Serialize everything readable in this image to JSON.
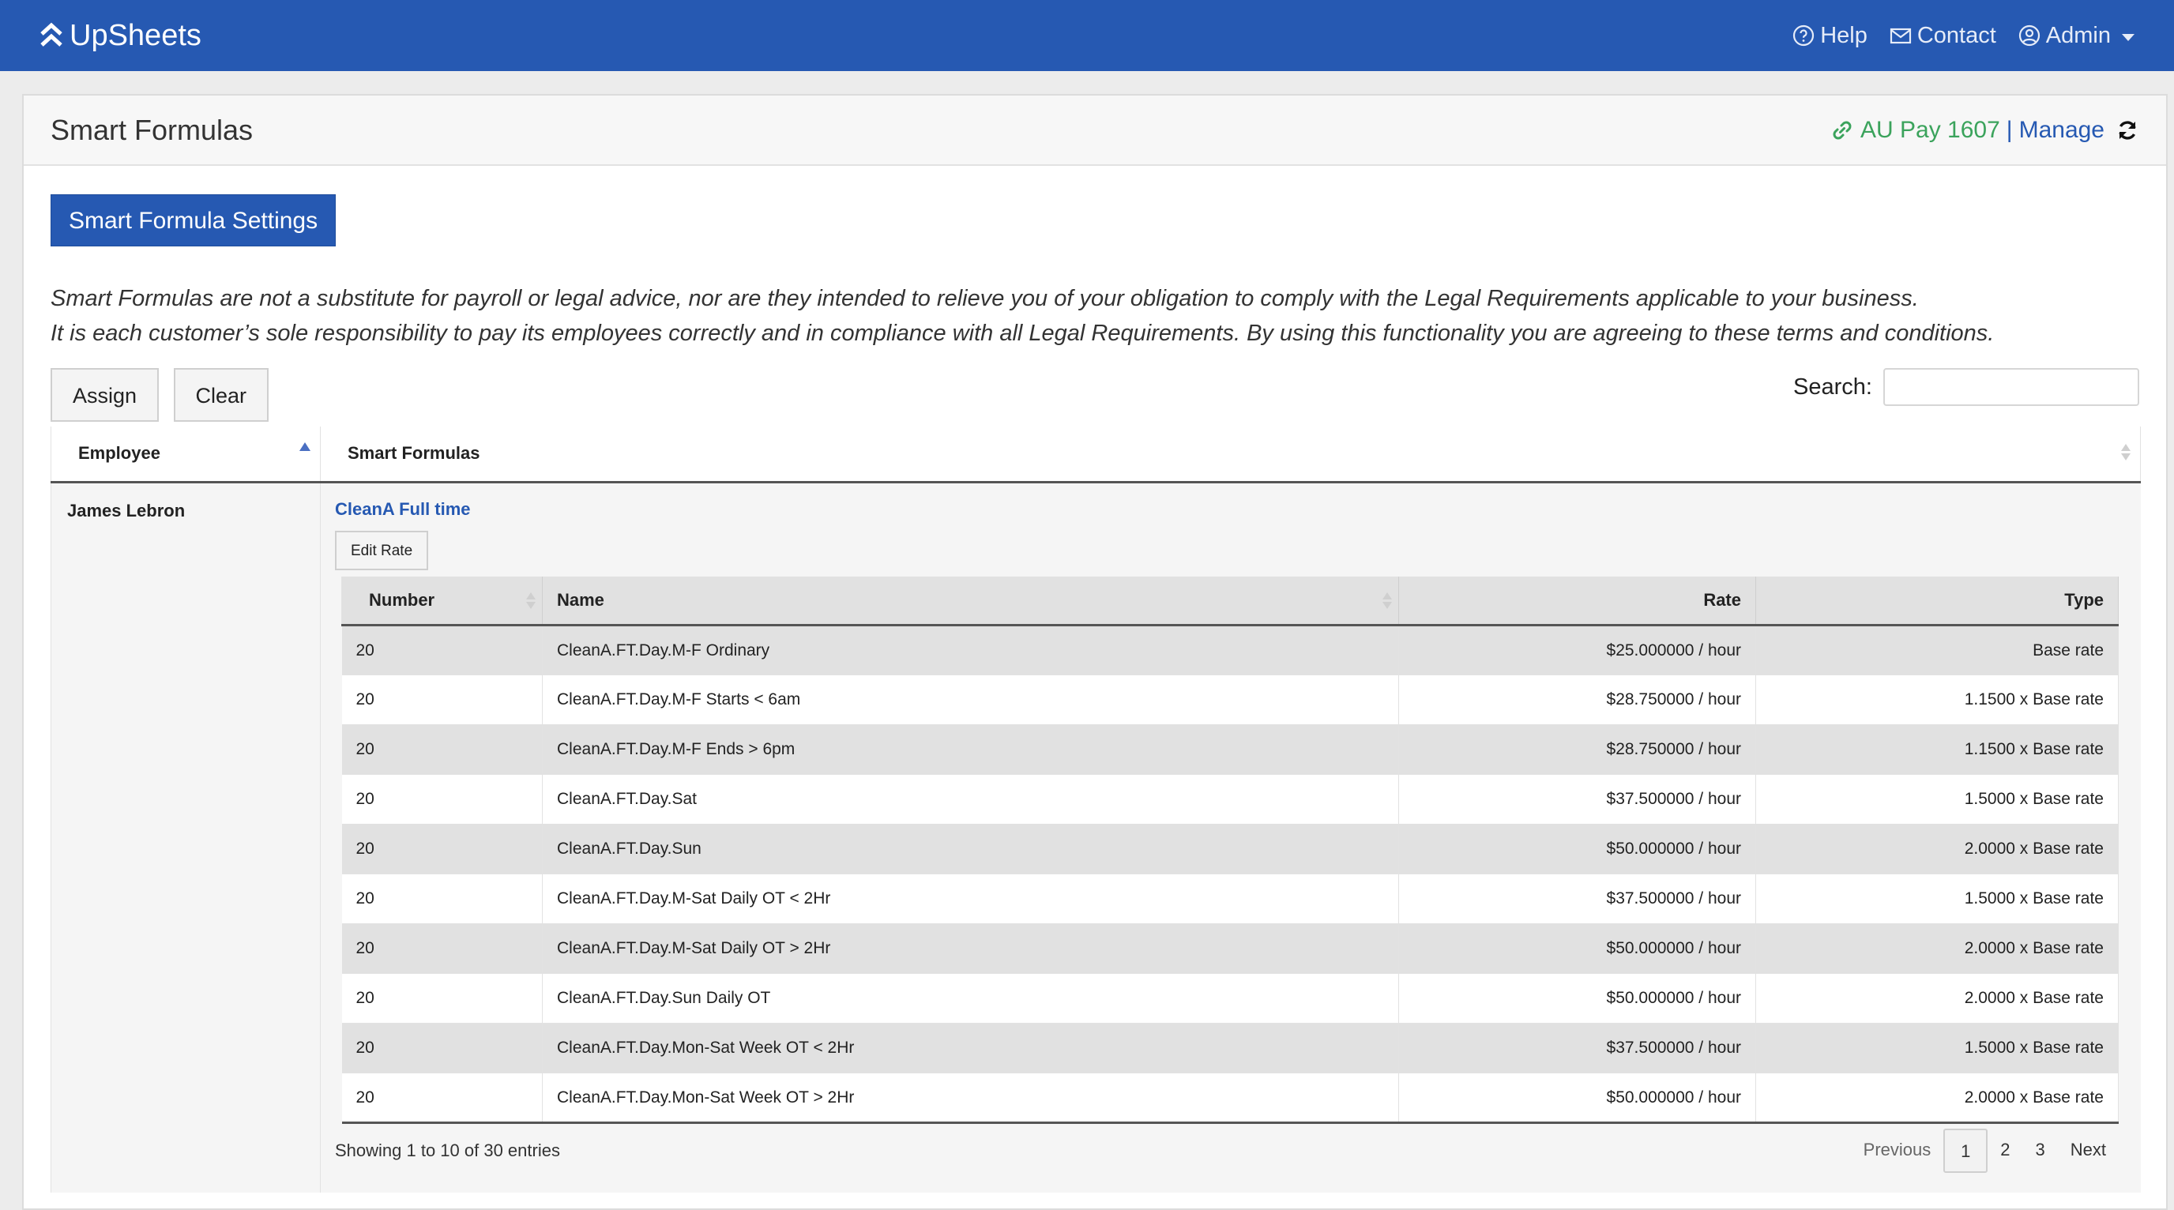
{
  "navbar": {
    "brand": "UpSheets",
    "help": "Help",
    "contact": "Contact",
    "admin": "Admin"
  },
  "panel": {
    "title": "Smart Formulas",
    "profile": "AU Pay 1607",
    "separator": "|",
    "manage": "Manage"
  },
  "settings_button": "Smart Formula Settings",
  "disclaimer": {
    "line1": "Smart Formulas are not a substitute for payroll or legal advice, nor are they intended to relieve you of your obligation to comply with the Legal Requirements applicable to your business.",
    "line2": "It is each customer’s sole responsibility to pay its employees correctly and in compliance with all Legal Requirements. By using this functionality you are agreeing to these terms and conditions."
  },
  "toolbar": {
    "assign": "Assign",
    "clear": "Clear",
    "search_label": "Search:",
    "search_value": ""
  },
  "outer_table": {
    "headers": [
      "Employee",
      "Smart Formulas"
    ],
    "employee": "James Lebron",
    "formula_name": "CleanA Full time",
    "edit_rate": "Edit Rate"
  },
  "inner_table": {
    "headers": [
      "Number",
      "Name",
      "Rate",
      "Type"
    ],
    "rows": [
      {
        "number": "20",
        "name": "CleanA.FT.Day.M-F Ordinary",
        "rate": "$25.000000 / hour",
        "type": "Base rate"
      },
      {
        "number": "20",
        "name": "CleanA.FT.Day.M-F Starts < 6am",
        "rate": "$28.750000 / hour",
        "type": "1.1500 x Base rate"
      },
      {
        "number": "20",
        "name": "CleanA.FT.Day.M-F Ends > 6pm",
        "rate": "$28.750000 / hour",
        "type": "1.1500 x Base rate"
      },
      {
        "number": "20",
        "name": "CleanA.FT.Day.Sat",
        "rate": "$37.500000 / hour",
        "type": "1.5000 x Base rate"
      },
      {
        "number": "20",
        "name": "CleanA.FT.Day.Sun",
        "rate": "$50.000000 / hour",
        "type": "2.0000 x Base rate"
      },
      {
        "number": "20",
        "name": "CleanA.FT.Day.M-Sat Daily OT < 2Hr",
        "rate": "$37.500000 / hour",
        "type": "1.5000 x Base rate"
      },
      {
        "number": "20",
        "name": "CleanA.FT.Day.M-Sat Daily OT > 2Hr",
        "rate": "$50.000000 / hour",
        "type": "2.0000 x Base rate"
      },
      {
        "number": "20",
        "name": "CleanA.FT.Day.Sun Daily OT",
        "rate": "$50.000000 / hour",
        "type": "2.0000 x Base rate"
      },
      {
        "number": "20",
        "name": "CleanA.FT.Day.Mon-Sat Week OT < 2Hr",
        "rate": "$37.500000 / hour",
        "type": "1.5000 x Base rate"
      },
      {
        "number": "20",
        "name": "CleanA.FT.Day.Mon-Sat Week OT > 2Hr",
        "rate": "$50.000000 / hour",
        "type": "2.0000 x Base rate"
      }
    ],
    "info": "Showing 1 to 10 of 30 entries"
  },
  "pagination": {
    "previous": "Previous",
    "pages": [
      "1",
      "2",
      "3"
    ],
    "next": "Next"
  },
  "colors": {
    "brand_blue": "#2659b2",
    "profile_green": "#3ba35c"
  },
  "icons": [
    "brand-chevron-icon",
    "help-circle-icon",
    "mail-icon",
    "user-circle-icon",
    "link-icon",
    "refresh-icon"
  ]
}
